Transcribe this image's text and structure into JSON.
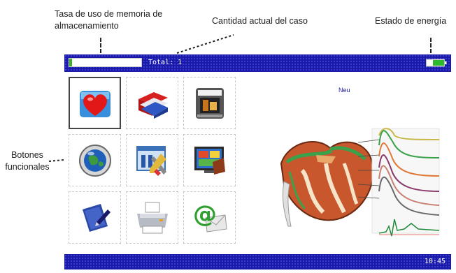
{
  "annotations": {
    "memory_usage": "Tasa de uso de memoria de almacenamiento",
    "case_count": "Cantidad actual del caso",
    "power_state": "Estado de energía",
    "function_buttons": "Botones funcionales"
  },
  "topbar": {
    "total_label": "Total: 1",
    "memory_usage_fraction": 0.04
  },
  "main": {
    "mode_label": "Neu"
  },
  "bottombar": {
    "clock": "10:45"
  },
  "colors": {
    "bar_blue": "#1a1aa8",
    "memory_green": "#3fae2a"
  },
  "function_icons": [
    "heart-icon",
    "folders-icon",
    "player-icon",
    "globe-icon",
    "settings-tools-icon",
    "display-icon",
    "notebook-icon",
    "printer-icon",
    "email-icon"
  ]
}
